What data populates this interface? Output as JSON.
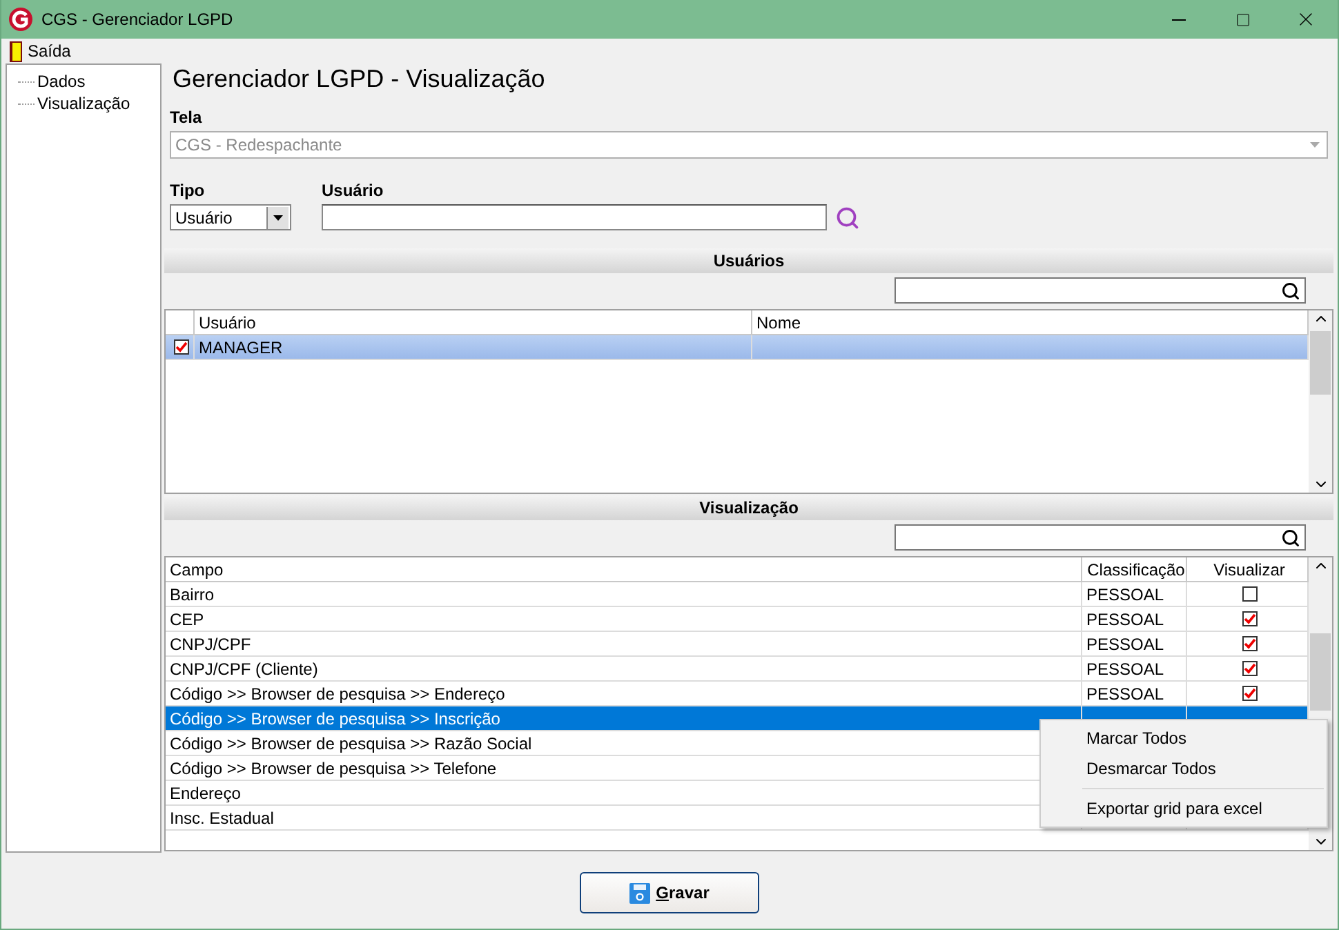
{
  "window": {
    "title": "CGS - Gerenciador LGPD"
  },
  "menu": [
    {
      "label": "Saída"
    }
  ],
  "tree": [
    {
      "label": "Dados"
    },
    {
      "label": "Visualização"
    }
  ],
  "heading": "Gerenciador LGPD - Visualização",
  "tela": {
    "label": "Tela",
    "value": "CGS - Redespachante",
    "disabled": true
  },
  "tipo": {
    "label": "Tipo",
    "value": "Usuário"
  },
  "usuario": {
    "label": "Usuário"
  },
  "users": {
    "title": "Usuários",
    "columns": [
      "Usuário",
      "Nome"
    ],
    "rows": [
      {
        "usuario": "MANAGER",
        "checked": true,
        "selected": true
      }
    ]
  },
  "view": {
    "title": "Visualização",
    "columns": [
      "Campo",
      "Classificação",
      "Visualizar"
    ],
    "rows": [
      {
        "campo": "Bairro",
        "classificacao": "PESSOAL",
        "visualizar": false,
        "selected": false
      },
      {
        "campo": "CEP",
        "classificacao": "PESSOAL",
        "visualizar": true,
        "selected": false
      },
      {
        "campo": "CNPJ/CPF",
        "classificacao": "PESSOAL",
        "visualizar": true,
        "selected": false
      },
      {
        "campo": "CNPJ/CPF (Cliente)",
        "classificacao": "PESSOAL",
        "visualizar": true,
        "selected": false
      },
      {
        "campo": "Código >> Browser de pesquisa >> Endereço",
        "classificacao": "PESSOAL",
        "visualizar": true,
        "selected": false
      },
      {
        "campo": "Código >> Browser de pesquisa >> Inscrição",
        "selected": true
      },
      {
        "campo": "Código >> Browser de pesquisa >> Razão Social",
        "selected": false
      },
      {
        "campo": "Código >> Browser de pesquisa >> Telefone",
        "selected": false
      },
      {
        "campo": "Endereço",
        "selected": false
      },
      {
        "campo": "Insc. Estadual",
        "selected": false
      }
    ]
  },
  "context_menu": [
    {
      "label": "Marcar Todos",
      "separator_before": false
    },
    {
      "label": "Desmarcar Todos",
      "separator_before": false
    },
    {
      "label": "Exportar grid para excel",
      "separator_before": true
    }
  ],
  "save_button": {
    "label": "Gravar"
  }
}
